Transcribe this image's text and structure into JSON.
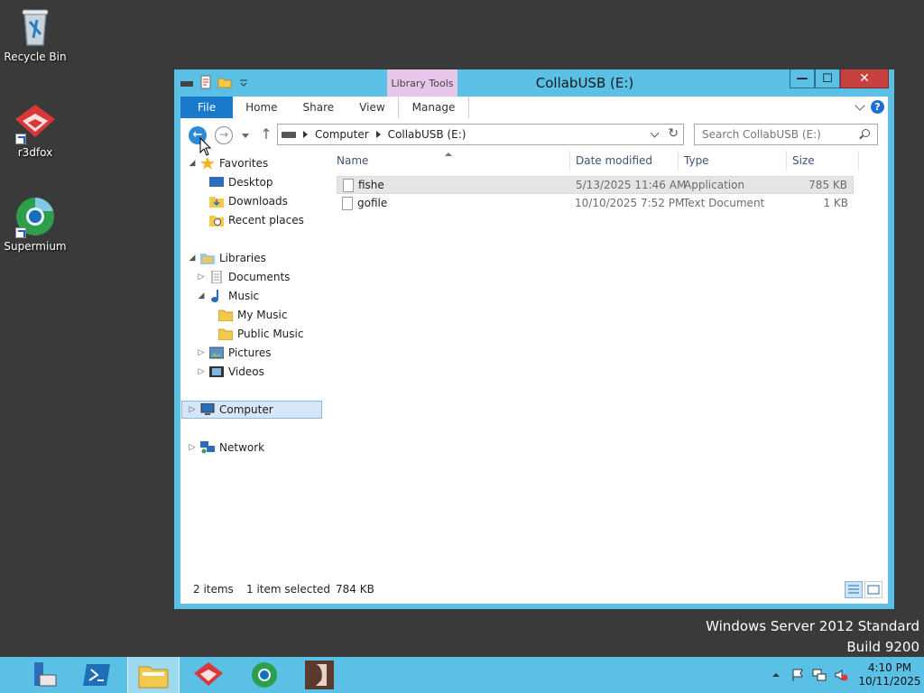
{
  "desktop": {
    "icons": [
      {
        "label": "Recycle Bin"
      },
      {
        "label": "r3dfox"
      },
      {
        "label": "Supermium"
      }
    ],
    "watermark_line1": "Windows Server 2012 Standard",
    "watermark_line2": "Build 9200"
  },
  "window": {
    "title": "CollabUSB (E:)",
    "contextual_group": "Library Tools",
    "tabs": [
      "File",
      "Home",
      "Share",
      "View",
      "Manage"
    ],
    "address": {
      "crumbs": [
        "Computer",
        "CollabUSB (E:)"
      ]
    },
    "search": {
      "placeholder": "Search CollabUSB (E:)"
    },
    "nav": {
      "favorites": "Favorites",
      "desktop": "Desktop",
      "downloads": "Downloads",
      "recent": "Recent places",
      "libraries": "Libraries",
      "documents": "Documents",
      "music": "Music",
      "my_music": "My Music",
      "public_music": "Public Music",
      "pictures": "Pictures",
      "videos": "Videos",
      "computer": "Computer",
      "network": "Network"
    },
    "columns": [
      "Name",
      "Date modified",
      "Type",
      "Size"
    ],
    "files": [
      {
        "name": "fishe",
        "date": "5/13/2025 11:46 AM",
        "type": "Application",
        "size": "785 KB"
      },
      {
        "name": "gofile",
        "date": "10/10/2025 7:52 PM",
        "type": "Text Document",
        "size": "1 KB"
      }
    ],
    "status": {
      "items": "2 items",
      "selected": "1 item selected",
      "selected_size": "784 KB"
    }
  },
  "taskbar": {
    "time": "4:10 PM",
    "date": "10/11/2025"
  },
  "colors": {
    "accent": "#5bc0e6",
    "file_tab": "#1979ca",
    "library_tools": "#e8c6ec",
    "close": "#c7423e"
  }
}
